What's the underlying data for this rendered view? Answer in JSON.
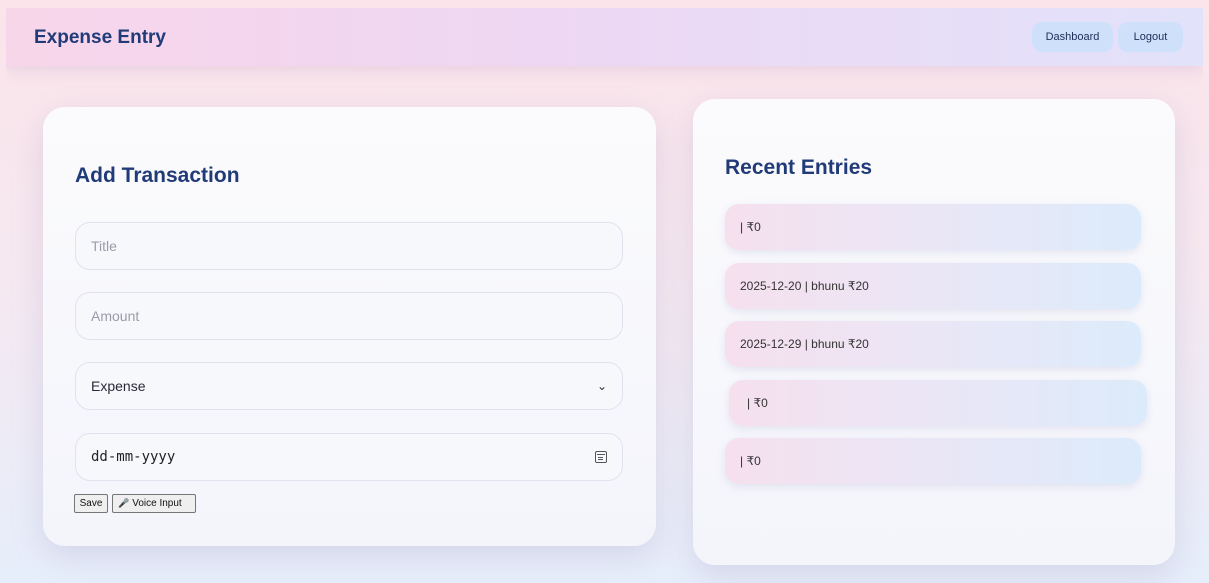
{
  "navbar": {
    "brand": "Expense Entry",
    "dashboard_label": "Dashboard",
    "logout_label": "Logout"
  },
  "form": {
    "title": "Add Transaction",
    "title_placeholder": "Title",
    "amount_placeholder": "Amount",
    "type_selected": "Expense",
    "date_placeholder": "dd-mm-yyyy",
    "save_label": "Save",
    "voice_label": "Voice Input"
  },
  "recent": {
    "title": "Recent Entries",
    "entries": [
      "| ₹0",
      "2025-12-20 | bhunu ₹20",
      "2025-12-29 | bhunu ₹20",
      "| ₹0",
      "| ₹0"
    ]
  }
}
